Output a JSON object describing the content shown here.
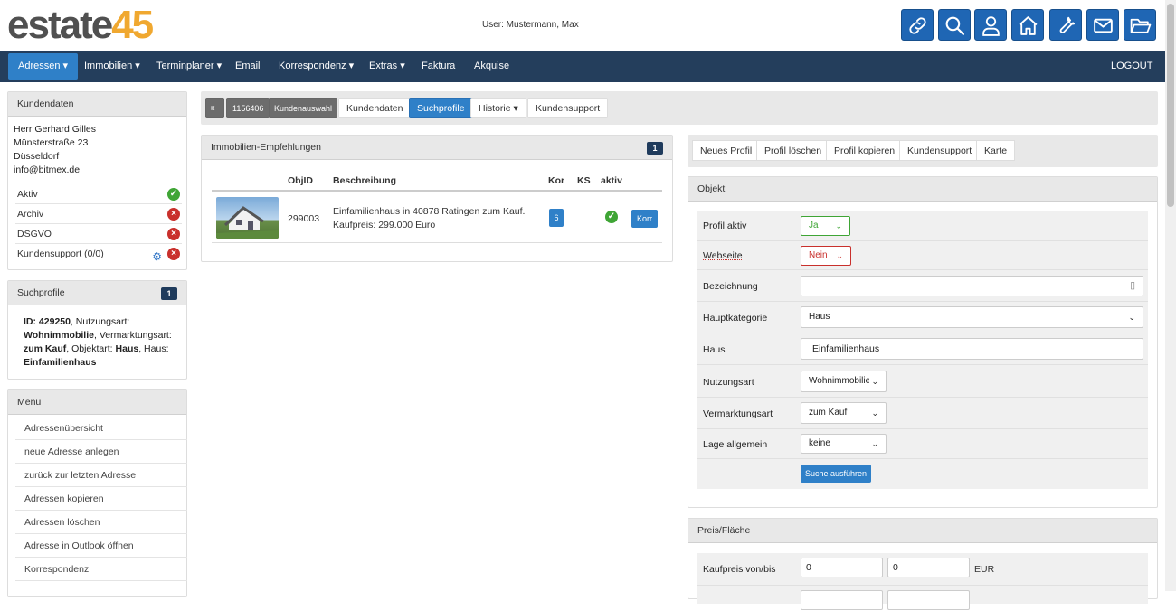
{
  "app": {
    "logo_part1": "estate",
    "logo_part2": "45",
    "user_text": "User: Mustermann, Max"
  },
  "toolbar_icons": [
    "link-icon",
    "search-icon",
    "user-icon",
    "home-icon",
    "wrench-icon",
    "mail-icon",
    "folder-icon"
  ],
  "nav": {
    "items": [
      "Adressen",
      "Immobilien",
      "Terminplaner",
      "Email",
      "Korrespondenz",
      "Extras",
      "Faktura",
      "Akquise"
    ],
    "logout": "LOGOUT"
  },
  "kundendaten": {
    "title": "Kundendaten",
    "name": "Herr Gerhard Gilles",
    "street": "Münsterstraße 23",
    "city": "Düsseldorf",
    "email": "info@bitmex.de",
    "status": [
      {
        "label": "Aktiv",
        "state": "ok"
      },
      {
        "label": "Archiv",
        "state": "no"
      },
      {
        "label": "DSGVO",
        "state": "no"
      },
      {
        "label": "Kundensupport (0/0)",
        "state": "no"
      }
    ]
  },
  "suchprofile": {
    "title": "Suchprofile",
    "count": "1",
    "id_label": "ID:",
    "id": "429250",
    "t1": ", Nutzungsart:",
    "nutzungsart": "Wohnimmobilie",
    "t2": ", Vermarktungsart:",
    "vermarktungsart": "zum Kauf",
    "t3": ", Objektart:",
    "objektart": "Haus",
    "t4": ", Haus:",
    "haus": "Einfamilienhaus"
  },
  "menu": {
    "title": "Menü",
    "items": [
      "Adressenübersicht",
      "neue Adresse anlegen",
      "zurück zur letzten Adresse",
      "Adressen kopieren",
      "Adressen löschen",
      "Adresse in Outlook öffnen",
      "Korrespondenz"
    ]
  },
  "subnav": {
    "first_icon": "⇤",
    "id": "1156406",
    "kundenauswahl": "Kundenauswahl",
    "kundendaten": "Kundendaten",
    "suchprofile": "Suchprofile",
    "historie": "Historie",
    "kundensupport": "Kundensupport"
  },
  "empfehlungen": {
    "title": "Immobilien-Empfehlungen",
    "count": "1",
    "headers": [
      "ObjID",
      "Beschreibung",
      "Kor",
      "KS",
      "aktiv"
    ],
    "row": {
      "objid": "299003",
      "desc1": "Einfamilienhaus in 40878 Ratingen zum Kauf.",
      "desc2": "Kaufpreis: 299.000 Euro",
      "kor": "6",
      "button": "Korr"
    }
  },
  "profile_actions": [
    "Neues Profil",
    "Profil löschen",
    "Profil kopieren",
    "Kundensupport",
    "Karte"
  ],
  "objekt": {
    "title": "Objekt",
    "profil_aktiv_label": "Profil aktiv",
    "profil_aktiv_value": "Ja",
    "webseite_label": "Webseite",
    "webseite_value": "Nein",
    "bezeichnung_label": "Bezeichnung",
    "bezeichnung_value": "",
    "hauptkategorie_label": "Hauptkategorie",
    "hauptkategorie_value": "Haus",
    "haus_label": "Haus",
    "haus_value": "Einfamilienhaus",
    "nutzungsart_label": "Nutzungsart",
    "nutzungsart_value": "Wohnimmobilie",
    "vermarktungsart_label": "Vermarktungsart",
    "vermarktungsart_value": "zum Kauf",
    "lage_label": "Lage allgemein",
    "lage_value": "keine",
    "search_button": "Suche ausführen"
  },
  "preis": {
    "title": "Preis/Fläche",
    "kaufpreis_label": "Kaufpreis von/bis",
    "von": "0",
    "bis": "0",
    "unit": "EUR"
  },
  "colors": {
    "nav_bg": "#243e5c",
    "accent": "#2f80c8",
    "ok": "#3fa535",
    "error": "#c9302c"
  }
}
